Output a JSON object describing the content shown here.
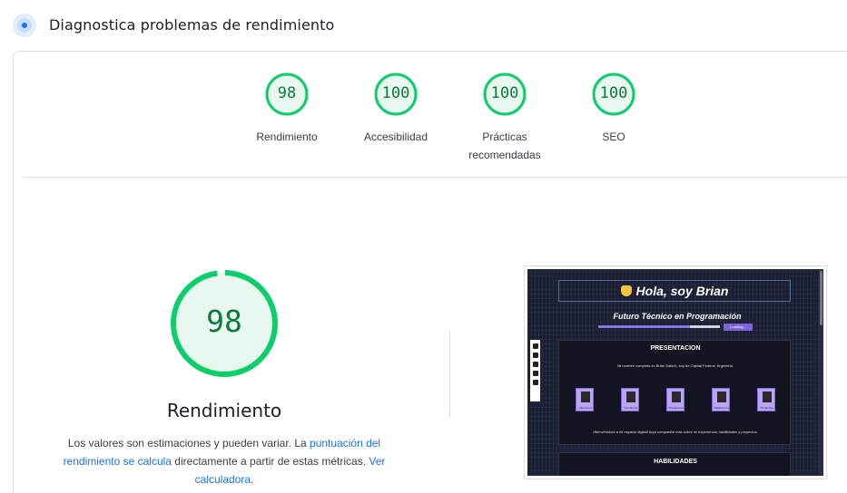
{
  "header": {
    "title": "Diagnostica problemas de rendimiento",
    "icon": "lighthouse-icon"
  },
  "scores": [
    {
      "id": "perf",
      "value": "98",
      "score": 98,
      "label": "Rendimiento"
    },
    {
      "id": "a11y",
      "value": "100",
      "score": 100,
      "label": "Accesibilidad"
    },
    {
      "id": "bp",
      "value": "100",
      "score": 100,
      "label": "Prácticas recomendadas"
    },
    {
      "id": "seo",
      "value": "100",
      "score": 100,
      "label": "SEO"
    }
  ],
  "main": {
    "score": "98",
    "score_value": 98,
    "label": "Rendimiento",
    "desc_prefix": "Los valores son estimaciones y pueden variar. La ",
    "desc_link1": "puntuación del rendimiento se calcula",
    "desc_middle": " directamente a partir de estas métricas. ",
    "desc_link2": "Ver calculadora",
    "desc_suffix": "."
  },
  "colors": {
    "pass": "#0cce6b",
    "pass_fill": "#e8f8ee",
    "pass_text": "#0c7b3a",
    "link": "#1a73e8"
  },
  "screenshot": {
    "title": "Hola, soy Brian",
    "subtitle": "Futuro Técnico en Programación",
    "progress": 0.75,
    "button": "Loading...",
    "panel_title": "PRESENTACION",
    "intro_line": "Mi nombre completo es Brian Sabich, soy de Capital Federal, Argentina.",
    "icons": [
      "Carrera tec",
      "Cambio tec",
      "Presenta tec",
      "Objetivos tec",
      "Fut tecnico"
    ],
    "welcome": "¡Bienvenido/a a mi espacio digital! Aquí compartiré más sobre mi experiencia, habilidades y proyectos.",
    "panel2_title": "HABILIDADES"
  }
}
